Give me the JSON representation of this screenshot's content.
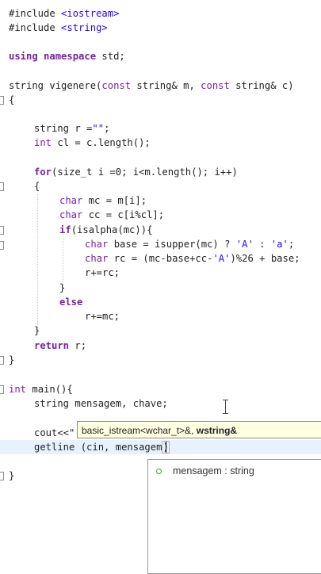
{
  "code": {
    "l1_pre": "#include ",
    "l1_str": "<iostream>",
    "l2_pre": "#include ",
    "l2_str": "<string>",
    "l4_kw": "using namespace",
    "l4_rest": " std;",
    "l6_a": "string vigenere(",
    "l6_kw1": "const",
    "l6_b": " string& m, ",
    "l6_kw2": "const",
    "l6_c": " string& c)",
    "l7": "{",
    "l9_a": "string r =",
    "l9_str": "\"\"",
    "l9_b": ";",
    "l10_kw": "int",
    "l10_rest": " cl = c.length();",
    "l12_kw": "for",
    "l12_rest": "(size_t i =0; i<m.length(); i++)",
    "l13": "{",
    "l14_kw": "char",
    "l14_rest": " mc = m[i];",
    "l15_kw": "char",
    "l15_rest": " cc = c[i%cl];",
    "l16_kw": "if",
    "l16_rest": "(isalpha(mc)){",
    "l17_kw": "char",
    "l17_a": " base = isupper(mc) ? ",
    "l17_s1": "'A'",
    "l17_b": " : ",
    "l17_s2": "'a'",
    "l17_c": ";",
    "l18_kw": "char",
    "l18_a": " rc = (mc-base+cc-",
    "l18_s": "'A'",
    "l18_b": ")%26 + base;",
    "l19": "r+=rc;",
    "l20": "}",
    "l21_kw": "else",
    "l22": "r+=mc;",
    "l23": "}",
    "l24_kw": "return",
    "l24_rest": " r;",
    "l25": "}",
    "l27_kw": "int",
    "l27_rest": " main(){",
    "l28": "string mensagem, chave;",
    "l30": "cout<<\"",
    "l31_a": "getline",
    "l31_b": " (cin, mensagem",
    "l31_c": ")",
    "l33": "}"
  },
  "tooltip": {
    "prefix": "basic_istream<wchar_t>&, ",
    "bold": "wstring&"
  },
  "autocomplete": {
    "items": [
      {
        "label": "mensagem : string",
        "icon": "public-field-icon"
      }
    ]
  }
}
